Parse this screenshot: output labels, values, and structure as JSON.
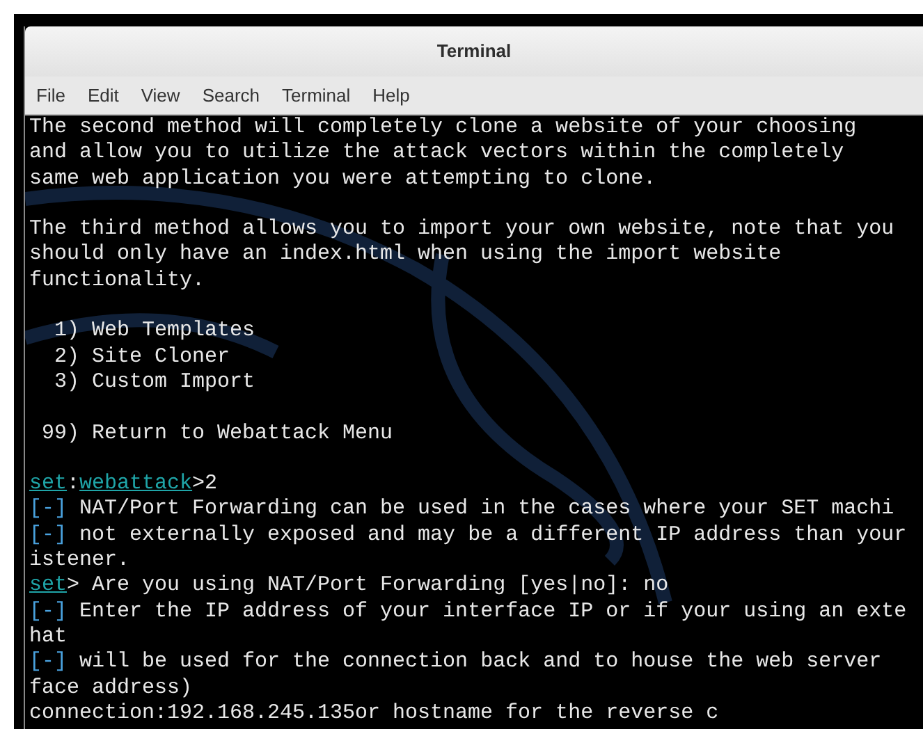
{
  "window": {
    "title": "Terminal"
  },
  "menu": [
    {
      "label": "File"
    },
    {
      "label": "Edit"
    },
    {
      "label": "View"
    },
    {
      "label": "Search"
    },
    {
      "label": "Terminal"
    },
    {
      "label": "Help"
    }
  ],
  "lines": [
    {
      "kind": "text",
      "segments": [
        {
          "kind": "plain",
          "text": "The second method will completely clone a website of your choosing"
        }
      ]
    },
    {
      "kind": "text",
      "segments": [
        {
          "kind": "plain",
          "text": "and allow you to utilize the attack vectors within the completely"
        }
      ]
    },
    {
      "kind": "text",
      "segments": [
        {
          "kind": "plain",
          "text": "same web application you were attempting to clone."
        }
      ]
    },
    {
      "kind": "blank"
    },
    {
      "kind": "text",
      "segments": [
        {
          "kind": "plain",
          "text": "The third method allows you to import your own website, note that you"
        }
      ]
    },
    {
      "kind": "text",
      "segments": [
        {
          "kind": "plain",
          "text": "should only have an index.html when using the import website"
        }
      ]
    },
    {
      "kind": "text",
      "segments": [
        {
          "kind": "plain",
          "text": "functionality."
        }
      ]
    },
    {
      "kind": "blank"
    },
    {
      "kind": "text",
      "segments": [
        {
          "kind": "plain",
          "text": "  1) Web Templates"
        }
      ]
    },
    {
      "kind": "text",
      "segments": [
        {
          "kind": "plain",
          "text": "  2) Site Cloner"
        }
      ]
    },
    {
      "kind": "text",
      "segments": [
        {
          "kind": "plain",
          "text": "  3) Custom Import"
        }
      ]
    },
    {
      "kind": "blank"
    },
    {
      "kind": "text",
      "segments": [
        {
          "kind": "plain",
          "text": " 99) Return to Webattack Menu"
        }
      ]
    },
    {
      "kind": "blank"
    },
    {
      "kind": "text",
      "segments": [
        {
          "kind": "link",
          "text": "set"
        },
        {
          "kind": "plain",
          "text": ":"
        },
        {
          "kind": "link",
          "text": "webattack"
        },
        {
          "kind": "plain",
          "text": ">2"
        }
      ]
    },
    {
      "kind": "text",
      "segments": [
        {
          "kind": "marker",
          "text": "[-]"
        },
        {
          "kind": "plain",
          "text": " NAT/Port Forwarding can be used in the cases where your SET machi"
        }
      ]
    },
    {
      "kind": "text",
      "segments": [
        {
          "kind": "marker",
          "text": "[-]"
        },
        {
          "kind": "plain",
          "text": " not externally exposed and may be a different IP address than your"
        }
      ]
    },
    {
      "kind": "text",
      "segments": [
        {
          "kind": "plain",
          "text": "istener."
        }
      ]
    },
    {
      "kind": "text",
      "segments": [
        {
          "kind": "link",
          "text": "set"
        },
        {
          "kind": "plain",
          "text": "> Are you using NAT/Port Forwarding [yes|no]: no"
        }
      ]
    },
    {
      "kind": "text",
      "segments": [
        {
          "kind": "marker",
          "text": "[-]"
        },
        {
          "kind": "plain",
          "text": " Enter the IP address of your interface IP or if your using an exte"
        }
      ]
    },
    {
      "kind": "text",
      "segments": [
        {
          "kind": "plain",
          "text": "hat"
        }
      ]
    },
    {
      "kind": "text",
      "segments": [
        {
          "kind": "marker",
          "text": "[-]"
        },
        {
          "kind": "plain",
          "text": " will be used for the connection back and to house the web server"
        }
      ]
    },
    {
      "kind": "text",
      "segments": [
        {
          "kind": "plain",
          "text": "face address)"
        }
      ]
    },
    {
      "kind": "text",
      "segments": [
        {
          "kind": "plain",
          "text": "connection:192.168.245.135or hostname for the reverse c"
        }
      ]
    }
  ]
}
